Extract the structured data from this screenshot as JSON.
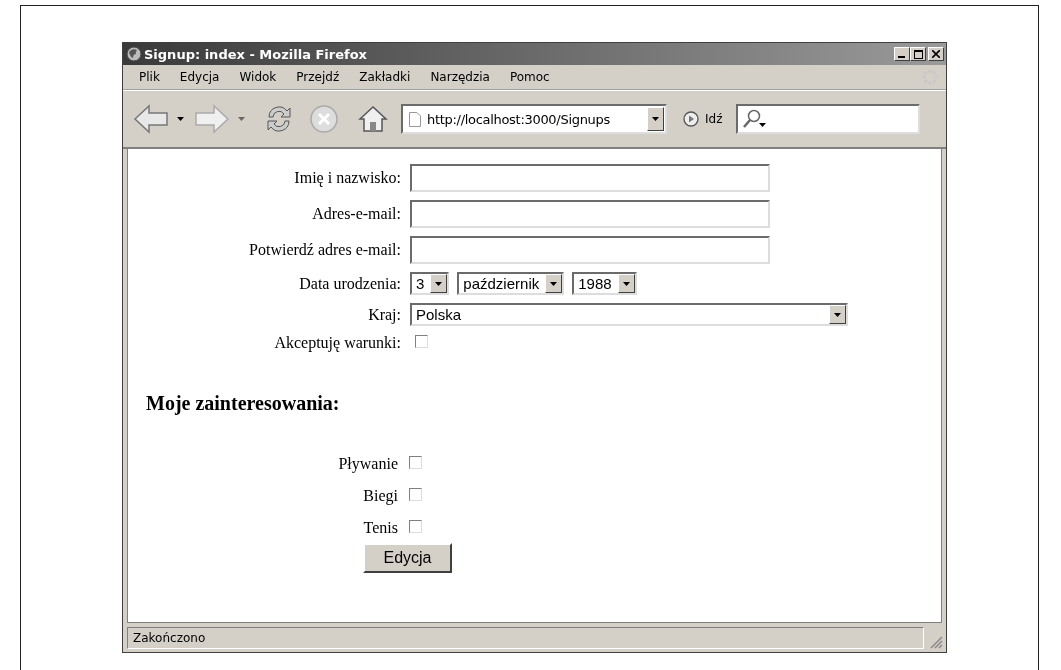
{
  "window": {
    "title": "Signup: index - Mozilla Firefox"
  },
  "menu": [
    "Plik",
    "Edycja",
    "Widok",
    "Przejdź",
    "Zakładki",
    "Narzędzia",
    "Pomoc"
  ],
  "toolbar": {
    "url": "http://localhost:3000/Signups",
    "go_label": "Idź"
  },
  "form": {
    "fields": [
      {
        "kind": "text",
        "label": "Imię i nazwisko:"
      },
      {
        "kind": "text",
        "label": "Adres-e-mail:"
      },
      {
        "kind": "text",
        "label": "Potwierdź adres e-mail:"
      },
      {
        "kind": "date",
        "label": "Data urodzenia:",
        "selects": [
          "3",
          "październik",
          "1988"
        ]
      },
      {
        "kind": "select",
        "label": "Kraj:",
        "value": "Polska"
      },
      {
        "kind": "checkbox",
        "label": "Akceptuję warunki:",
        "checked": false
      }
    ]
  },
  "interests": {
    "heading": "Moje zainteresowania:",
    "items": [
      {
        "label": "Pływanie",
        "checked": false
      },
      {
        "label": "Biegi",
        "checked": false
      },
      {
        "label": "Tenis",
        "checked": false
      }
    ]
  },
  "submit": "Edycja",
  "status_bar": "Zakończono"
}
